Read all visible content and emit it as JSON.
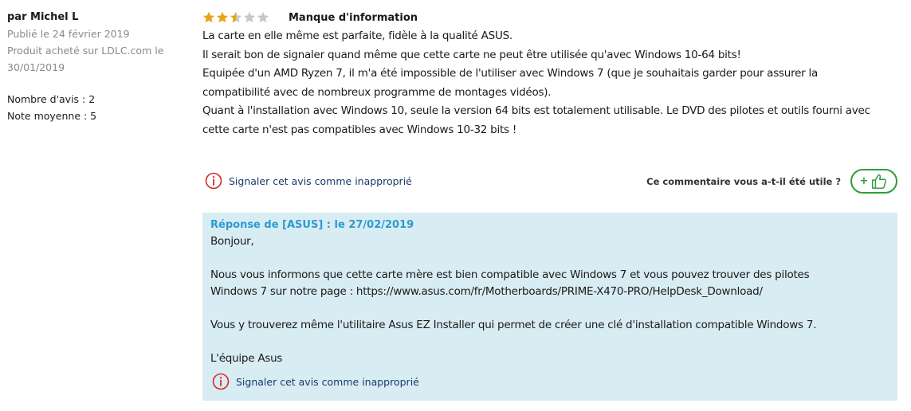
{
  "author": {
    "name": "par Michel L",
    "published": "Publié le 24 février 2019",
    "purchased_line1": "Produit acheté sur LDLC.com le",
    "purchased_line2": "30/01/2019",
    "review_count": "Nombre d'avis : 2",
    "average_rating": "Note moyenne : 5"
  },
  "review": {
    "rating": 2.5,
    "rating_max": 5,
    "title": "Manque d'information",
    "lines": [
      "La carte en elle même est parfaite, fidèle à la qualité ASUS.",
      "Il serait bon de signaler quand même que cette carte ne peut être utilisée qu'avec Windows 10-64 bits!",
      "Equipée d'un AMD Ryzen 7, il m'a été impossible de l'utiliser avec Windows 7 (que je souhaitais garder pour assurer la",
      "compatibilité avec de nombreux programme de montages vidéos).",
      "Quant à l'installation avec Windows 10, seule la version 64 bits est totalement utilisable. Le DVD des pilotes et outils fourni avec",
      "cette carte n'est pas compatibles avec Windows 10-32 bits !"
    ]
  },
  "actions": {
    "report_label": "Signaler cet avis comme inapproprié",
    "useful_question": "Ce commentaire vous a-t-il été utile ?",
    "useful_plus": "+"
  },
  "reply": {
    "header": "Réponse de [ASUS] : le 27/02/2019",
    "lines": [
      "Bonjour,",
      "",
      "Nous vous informons que cette carte mère est bien compatible avec Windows 7 et vous pouvez trouver des pilotes",
      "Windows 7 sur notre page : https://www.asus.com/fr/Motherboards/PRIME-X470-PRO/HelpDesk_Download/",
      "",
      "Vous y trouverez même l'utilitaire Asus EZ Installer qui permet de créer une clé d'installation compatible Windows 7.",
      "",
      "L'équipe Asus"
    ],
    "report_label": "Signaler cet avis comme inapproprié"
  },
  "colors": {
    "star_filled": "#e8a317",
    "star_empty": "#c8c8c8",
    "report_red": "#d62828",
    "useful_green": "#2e9e3a",
    "reply_background": "#d8ecf3",
    "reply_header": "#2d9bd0"
  },
  "icons": {
    "star": "star-icon",
    "report": "warning-circle-icon",
    "useful": "thumbs-up-icon"
  }
}
